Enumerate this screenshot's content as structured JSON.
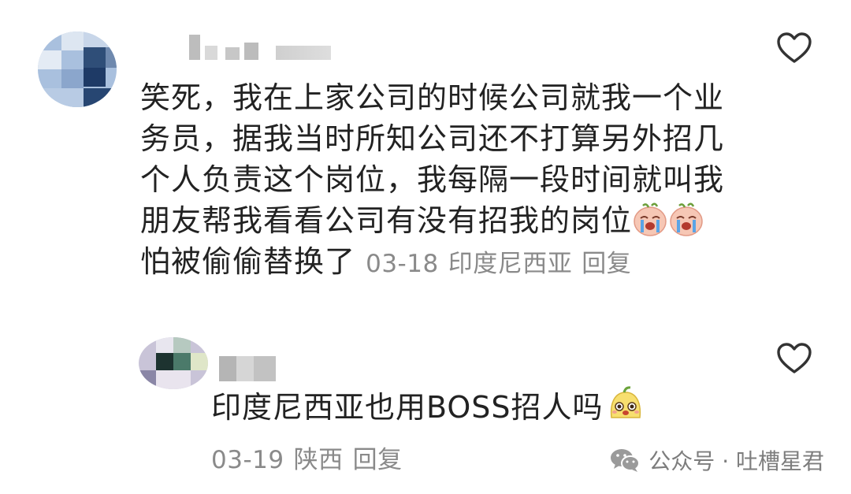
{
  "comment1": {
    "text_lines": [
      "笑死，我在上家公司的时候公司就我一个业",
      "务员，据我当时所知公司还不打算另外招几",
      "个人负责这个岗位，我每隔一段时间就叫我",
      "朋友帮我看看公司有没有招我的岗位",
      "怕被偷偷替换了"
    ],
    "emojis": [
      "crying-face-icon",
      "crying-face-icon"
    ],
    "date": "03-18",
    "location": "印度尼西亚",
    "reply_label": "回复"
  },
  "comment2": {
    "text": "印度尼西亚也用BOSS招人吗",
    "emoji": "cute-face-icon",
    "date": "03-19",
    "location": "陕西",
    "reply_label": "回复"
  },
  "watermark": {
    "text": "公众号 · 吐槽星君",
    "icon": "wechat-icon"
  },
  "colors": {
    "text": "#222222",
    "meta": "#8a8a8a",
    "icon": "#333333"
  }
}
